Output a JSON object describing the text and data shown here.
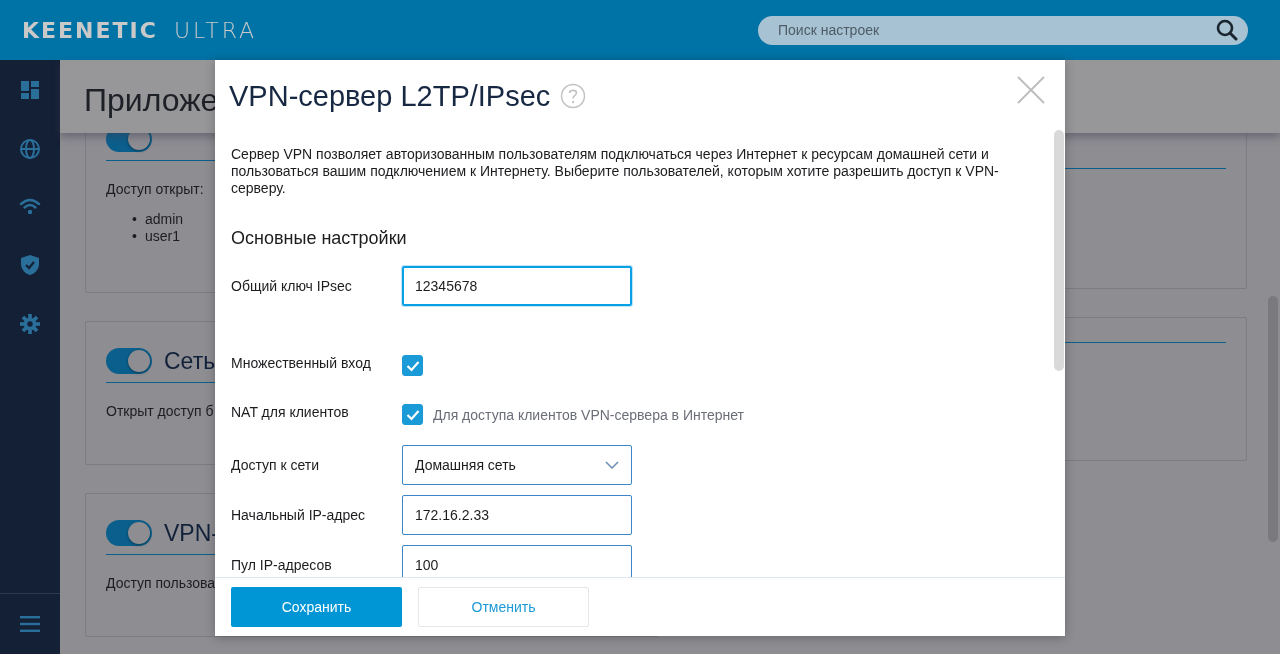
{
  "header": {
    "logo": "KEENETIC",
    "model": "ULTRA",
    "search": {
      "placeholder": "Поиск настроек"
    }
  },
  "page": {
    "title": "Приложе",
    "cards": [
      {
        "on": true,
        "text": "Доступ открыт:",
        "marker": "•",
        "list": [
          "admin",
          "user1"
        ]
      },
      {
        "title": "Сеть",
        "on": true,
        "text": "Открыт доступ б"
      },
      {
        "title": "VPN-",
        "on": true,
        "text": "Доступ пользова"
      }
    ]
  },
  "dialog": {
    "title": "VPN-сервер L2TP/IPsec",
    "description": "Сервер VPN позволяет авторизованным пользователям подключаться через Интернет к ресурсам домашней сети и пользоваться вашим подключением к Интернету. Выберите пользователей, которым хотите разрешить доступ к VPN-серверу.",
    "section": "Основные настройки",
    "fields": [
      {
        "kind": "text",
        "label": "Общий ключ IPsec",
        "value": "12345678",
        "focused": true
      },
      {
        "kind": "checkbox",
        "label": "Множественный вход",
        "checked": true
      },
      {
        "kind": "checkbox",
        "label": "NAT для клиентов",
        "checked": true,
        "hint": "Для доступа клиентов VPN-сервера в Интернет"
      },
      {
        "kind": "select",
        "label": "Доступ к сети",
        "value": "Домашняя сеть"
      },
      {
        "kind": "text",
        "label": "Начальный IP-адрес",
        "value": "172.16.2.33",
        "focused": false
      },
      {
        "kind": "text",
        "label": "Пул IP-адресов",
        "value": "100",
        "focused": false
      }
    ],
    "buttons": [
      {
        "label": "Сохранить",
        "primary": true
      },
      {
        "label": "Отменить",
        "primary": false
      }
    ]
  }
}
